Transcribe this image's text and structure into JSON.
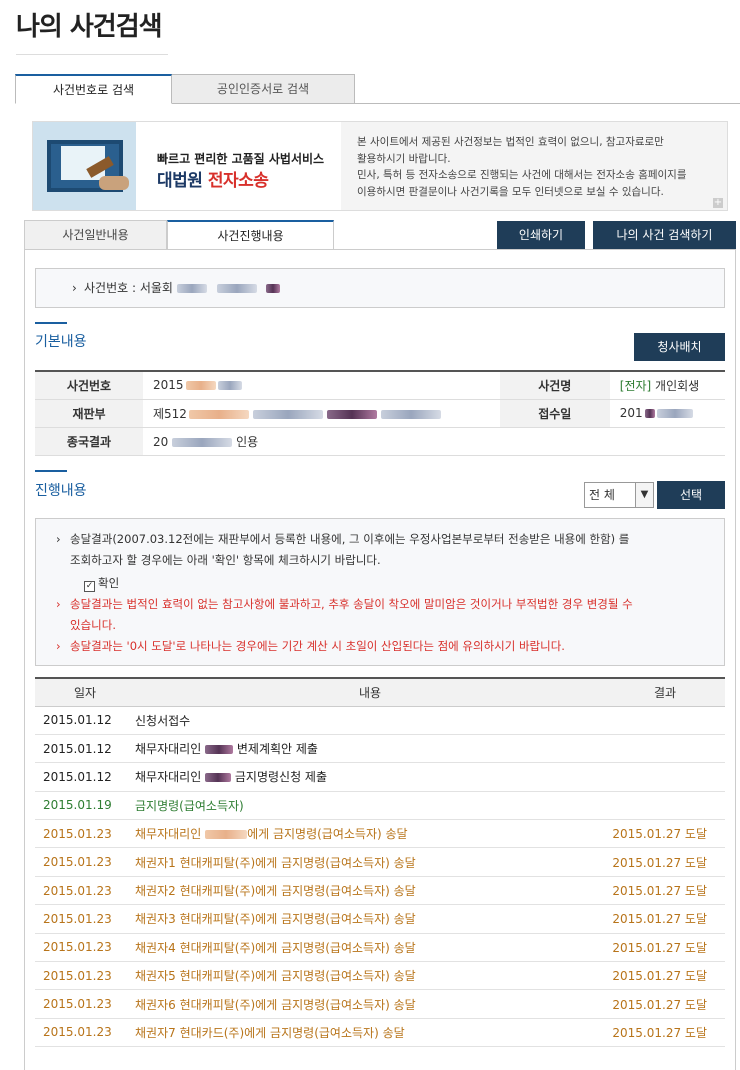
{
  "page_title": "나의 사건검색",
  "top_tabs": [
    {
      "label": "사건번호로 검색",
      "active": true
    },
    {
      "label": "공인인증서로 검색",
      "active": false
    }
  ],
  "banner": {
    "subtitle": "빠르고 편리한 고품질 사법서비스",
    "brand_main": "대법원",
    "brand_accent": "전자소송",
    "notice_line1": "본 사이트에서 제공된 사건정보는 법적인 효력이 없으니, 참고자료로만",
    "notice_line2": "활용하시기 바랍니다.",
    "notice_line3": "민사, 특허 등 전자소송으로 진행되는 사건에 대해서는 전자소송 홈페이지를",
    "notice_line4": "이용하시면 판결문이나 사건기록을 모두 인터넷으로 보실 수 있습니다.",
    "plus": "+"
  },
  "sub_tabs": [
    {
      "label": "사건일반내용",
      "active": false
    },
    {
      "label": "사건진행내용",
      "active": true
    }
  ],
  "buttons": {
    "print": "인쇄하기",
    "my_case_search": "나의 사건 검색하기",
    "court_arrangement": "청사배치",
    "select": "선택"
  },
  "case_number": {
    "bullet": "›",
    "label": "사건번호 : 서울회"
  },
  "basic": {
    "title": "기본내용",
    "rows": [
      {
        "label1": "사건번호",
        "value1": "2015",
        "label2": "사건명",
        "value2_tag": "[전자]",
        "value2": "개인회생"
      },
      {
        "label1": "재판부",
        "value1": "제512",
        "label2": "접수일",
        "value2": "201"
      },
      {
        "label1": "종국결과",
        "value1": "20",
        "value1_tail": "인용"
      }
    ]
  },
  "progress": {
    "title": "진행내용",
    "filter_value": "전 체",
    "filter_arrow": "▼",
    "notice": {
      "bullet": "›",
      "line1": "송달결과(2007.03.12전에는 재판부에서 등록한 내용에, 그 이후에는 우정사업본부로부터 전송받은 내용에 한함) 를",
      "line2": "조회하고자 할 경우에는 아래 '확인' 항목에 체크하시기 바랍니다.",
      "checkbox_mark": "✓",
      "checkbox_label": "확인",
      "red1_line1": "송달결과는 법적인 효력이 없는 참고사항에 불과하고, 추후 송달이 착오에 말미암은 것이거나 부적법한 경우 변경될 수",
      "red1_line2": "있습니다.",
      "red2": "송달결과는 '0시 도달'로 나타나는 경우에는 기간 계산 시 초일이 산입된다는 점에 유의하시기 바랍니다."
    },
    "headers": {
      "date": "일자",
      "content": "내용",
      "result": "결과"
    },
    "rows": [
      {
        "date": "2015.01.12",
        "content": "신청서접수",
        "result": "",
        "color": "black"
      },
      {
        "date": "2015.01.12",
        "content_pre": "채무자대리인 ",
        "content_post": " 변제계획안 제출",
        "result": "",
        "color": "black"
      },
      {
        "date": "2015.01.12",
        "content_pre": "채무자대리인 ",
        "content_post": " 금지명령신청 제출",
        "result": "",
        "color": "black"
      },
      {
        "date": "2015.01.19",
        "content": "금지명령(급여소득자)",
        "result": "",
        "color": "green"
      },
      {
        "date": "2015.01.23",
        "content_pre": "채무자대리인 ",
        "content_post": "에게 금지명령(급여소득자) 송달",
        "result": "2015.01.27 도달",
        "color": "orange"
      },
      {
        "date": "2015.01.23",
        "content": "채권자1 현대캐피탈(주)에게 금지명령(급여소득자) 송달",
        "result": "2015.01.27 도달",
        "color": "orange"
      },
      {
        "date": "2015.01.23",
        "content": "채권자2 현대캐피탈(주)에게 금지명령(급여소득자) 송달",
        "result": "2015.01.27 도달",
        "color": "orange"
      },
      {
        "date": "2015.01.23",
        "content": "채권자3 현대캐피탈(주)에게 금지명령(급여소득자) 송달",
        "result": "2015.01.27 도달",
        "color": "orange"
      },
      {
        "date": "2015.01.23",
        "content": "채권자4 현대캐피탈(주)에게 금지명령(급여소득자) 송달",
        "result": "2015.01.27 도달",
        "color": "orange"
      },
      {
        "date": "2015.01.23",
        "content": "채권자5 현대캐피탈(주)에게 금지명령(급여소득자) 송달",
        "result": "2015.01.27 도달",
        "color": "orange"
      },
      {
        "date": "2015.01.23",
        "content": "채권자6 현대캐피탈(주)에게 금지명령(급여소득자) 송달",
        "result": "2015.01.27 도달",
        "color": "orange"
      },
      {
        "date": "2015.01.23",
        "content": "채권자7 현대카드(주)에게 금지명령(급여소득자) 송달",
        "result": "2015.01.27 도달",
        "color": "orange"
      }
    ]
  },
  "colors": {
    "accent": "#1a5fa0",
    "button_dark": "#1f3d58",
    "green": "#2e7d32",
    "orange": "#b8741a",
    "red": "#d8302b"
  }
}
